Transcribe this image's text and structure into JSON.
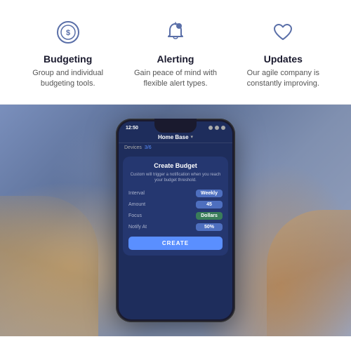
{
  "features": [
    {
      "id": "budgeting",
      "title": "Budgeting",
      "desc": "Group and individual budgeting tools.",
      "icon": "coin"
    },
    {
      "id": "alerting",
      "title": "Alerting",
      "desc": "Gain peace of mind with flexible alert types.",
      "icon": "bell"
    },
    {
      "id": "updates",
      "title": "Updates",
      "desc": "Our agile company is constantly improving.",
      "icon": "heart"
    }
  ],
  "phone": {
    "status_time": "12:50",
    "nav_title": "Home Base",
    "nav_arrow": "▾",
    "devices_label": "Devices",
    "devices_count": "3/6",
    "card_title": "Create Budget",
    "card_desc": "Custom will trigger a notification when you reach your budget threshold.",
    "rows": [
      {
        "label": "Interval",
        "value": "Weekly"
      },
      {
        "label": "Amount",
        "value": "45"
      },
      {
        "label": "Focus",
        "value": "Dollars"
      },
      {
        "label": "Notify At",
        "value": "50%"
      }
    ],
    "create_btn": "CREATE"
  }
}
